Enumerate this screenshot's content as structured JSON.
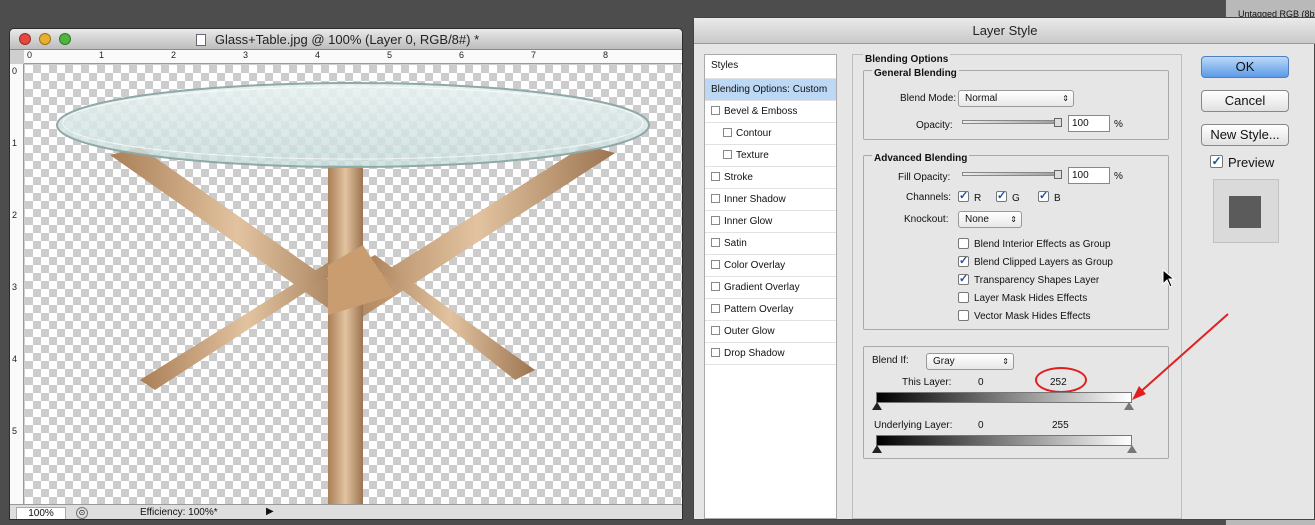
{
  "document": {
    "filename": "Glass+Table.jpg @ 100% (Layer 0, RGB/8#) *",
    "zoom": "100%",
    "efficiency": "Efficiency: 100%*",
    "ruler_h": [
      "0",
      "1",
      "2",
      "3",
      "4",
      "5",
      "6",
      "7",
      "8"
    ],
    "ruler_v": [
      "0",
      "1",
      "2",
      "3",
      "4",
      "5"
    ]
  },
  "dialog": {
    "title": "Layer Style",
    "styles_header": "Styles",
    "style_items": [
      {
        "label": "Blending Options: Custom",
        "checkbox": false,
        "selected": true,
        "indent": false
      },
      {
        "label": "Bevel & Emboss",
        "checkbox": true,
        "selected": false,
        "indent": false
      },
      {
        "label": "Contour",
        "checkbox": true,
        "selected": false,
        "indent": true
      },
      {
        "label": "Texture",
        "checkbox": true,
        "selected": false,
        "indent": true
      },
      {
        "label": "Stroke",
        "checkbox": true,
        "selected": false,
        "indent": false
      },
      {
        "label": "Inner Shadow",
        "checkbox": true,
        "selected": false,
        "indent": false
      },
      {
        "label": "Inner Glow",
        "checkbox": true,
        "selected": false,
        "indent": false
      },
      {
        "label": "Satin",
        "checkbox": true,
        "selected": false,
        "indent": false
      },
      {
        "label": "Color Overlay",
        "checkbox": true,
        "selected": false,
        "indent": false
      },
      {
        "label": "Gradient Overlay",
        "checkbox": true,
        "selected": false,
        "indent": false
      },
      {
        "label": "Pattern Overlay",
        "checkbox": true,
        "selected": false,
        "indent": false
      },
      {
        "label": "Outer Glow",
        "checkbox": true,
        "selected": false,
        "indent": false
      },
      {
        "label": "Drop Shadow",
        "checkbox": true,
        "selected": false,
        "indent": false
      }
    ],
    "blending_options_title": "Blending Options",
    "general_blending": {
      "title": "General Blending",
      "blend_mode_label": "Blend Mode:",
      "blend_mode_value": "Normal",
      "opacity_label": "Opacity:",
      "opacity_value": "100",
      "percent": "%"
    },
    "advanced_blending": {
      "title": "Advanced Blending",
      "fill_opacity_label": "Fill Opacity:",
      "fill_opacity_value": "100",
      "percent": "%",
      "channels_label": "Channels:",
      "channel_r": "R",
      "channel_g": "G",
      "channel_b": "B",
      "knockout_label": "Knockout:",
      "knockout_value": "None",
      "options": [
        {
          "label": "Blend Interior Effects as Group",
          "checked": false
        },
        {
          "label": "Blend Clipped Layers as Group",
          "checked": true
        },
        {
          "label": "Transparency Shapes Layer",
          "checked": true
        },
        {
          "label": "Layer Mask Hides Effects",
          "checked": false
        },
        {
          "label": "Vector Mask Hides Effects",
          "checked": false
        }
      ]
    },
    "blend_if": {
      "label": "Blend If:",
      "value": "Gray",
      "this_layer_label": "This Layer:",
      "this_layer_low": "0",
      "this_layer_high": "252",
      "underlying_label": "Underlying Layer:",
      "underlying_low": "0",
      "underlying_high": "255"
    },
    "buttons": {
      "ok": "OK",
      "cancel": "Cancel",
      "new_style": "New Style...",
      "preview_label": "Preview"
    }
  },
  "right_panel": {
    "label": "Untagged RGB (8b"
  },
  "colors": {
    "annotation_red": "#e02020",
    "ok_blue": "#5b9ae8",
    "selected_item": "#bcd8f5"
  }
}
